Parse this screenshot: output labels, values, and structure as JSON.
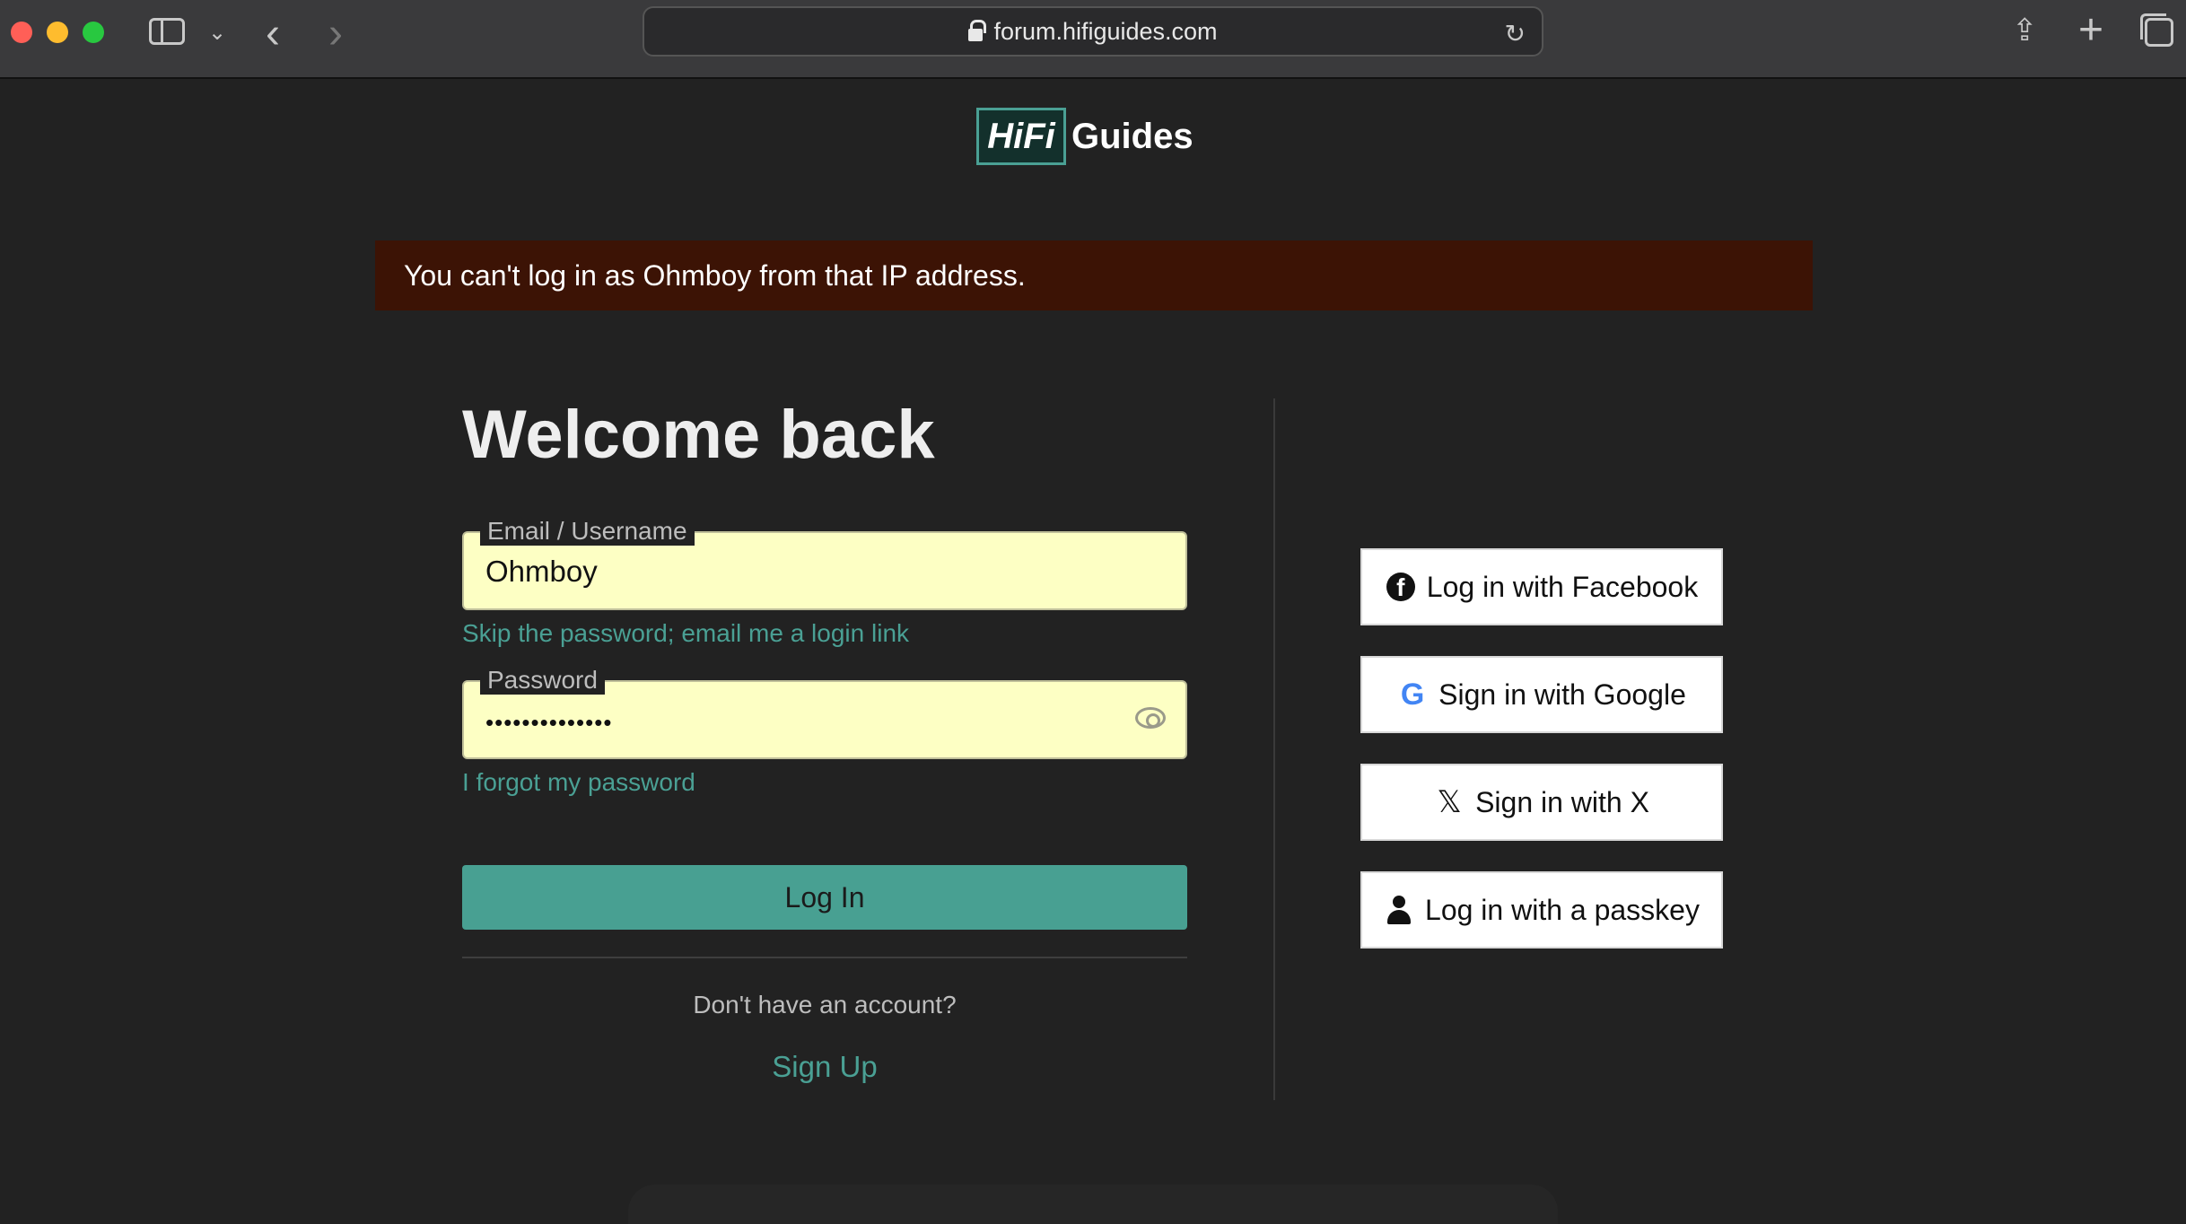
{
  "browser": {
    "url": "forum.hifiguides.com"
  },
  "logo": {
    "mark": "HiFi",
    "text": "Guides"
  },
  "alert": {
    "message": "You can't log in as Ohmboy from that IP address."
  },
  "login": {
    "title": "Welcome back",
    "email_label": "Email / Username",
    "email_value": "Ohmboy",
    "skip_password_link": "Skip the password; email me a login link",
    "password_label": "Password",
    "password_value": "••••••••••••••",
    "forgot_link": "I forgot my password",
    "login_button": "Log In",
    "no_account_text": "Don't have an account?",
    "signup_link": "Sign Up"
  },
  "social": {
    "facebook": "Log in with Facebook",
    "google": "Sign in with Google",
    "x": "Sign in with X",
    "passkey": "Log in with a passkey"
  },
  "colors": {
    "accent": "#48a092",
    "alert_bg": "#3c1305",
    "page_bg": "#222222",
    "input_bg": "#fdffc4"
  }
}
